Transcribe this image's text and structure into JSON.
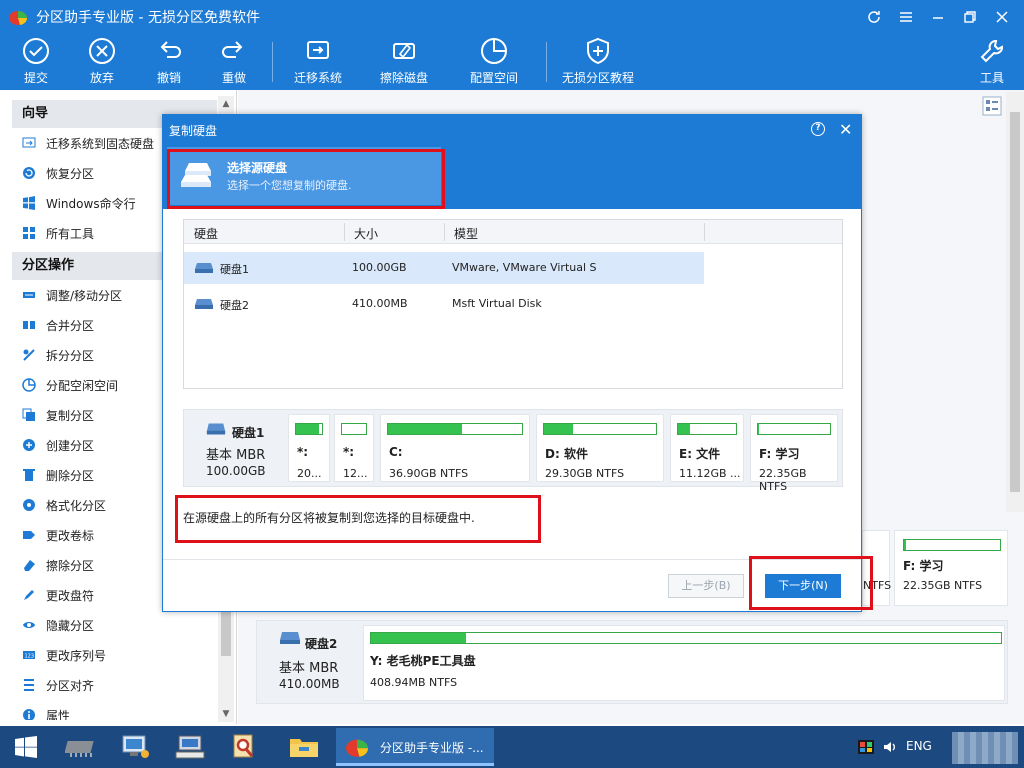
{
  "window": {
    "title": "分区助手专业版 - 无损分区免费软件"
  },
  "toolbar": {
    "commit": "提交",
    "discard": "放弃",
    "undo": "撤销",
    "redo": "重做",
    "migrate": "迁移系统",
    "wipe": "擦除磁盘",
    "allocate": "配置空间",
    "tutorial": "无损分区教程",
    "tools": "工具"
  },
  "sidebar": {
    "wizard_head": "向导",
    "wizard": [
      {
        "label": "迁移系统到固态硬盘",
        "icon": "migrate-icon"
      },
      {
        "label": "恢复分区",
        "icon": "recover-icon"
      },
      {
        "label": "Windows命令行",
        "icon": "windows-icon"
      },
      {
        "label": "所有工具",
        "icon": "grid-icon"
      }
    ],
    "ops_head": "分区操作",
    "ops": [
      {
        "label": "调整/移动分区",
        "icon": "resize-icon"
      },
      {
        "label": "合并分区",
        "icon": "merge-icon"
      },
      {
        "label": "拆分分区",
        "icon": "split-icon"
      },
      {
        "label": "分配空闲空间",
        "icon": "allocate-icon"
      },
      {
        "label": "复制分区",
        "icon": "copy-icon"
      },
      {
        "label": "创建分区",
        "icon": "create-icon"
      },
      {
        "label": "删除分区",
        "icon": "delete-icon"
      },
      {
        "label": "格式化分区",
        "icon": "format-icon"
      },
      {
        "label": "更改卷标",
        "icon": "label-icon"
      },
      {
        "label": "擦除分区",
        "icon": "eraser-icon"
      },
      {
        "label": "更改盘符",
        "icon": "letter-icon"
      },
      {
        "label": "隐藏分区",
        "icon": "eye-icon"
      },
      {
        "label": "更改序列号",
        "icon": "serial-icon"
      },
      {
        "label": "分区对齐",
        "icon": "align-icon"
      },
      {
        "label": "属性",
        "icon": "info-icon"
      }
    ]
  },
  "background": {
    "f_card": {
      "name": "F: 学习",
      "size": "22.35GB NTFS",
      "used": 0.02
    },
    "disk2": {
      "name": "硬盘2",
      "type": "基本 MBR",
      "size": "410.00MB",
      "part_name": "Y: 老毛桃PE工具盘",
      "part_size": "408.94MB NTFS",
      "used": 0.15,
      "partial_label": "NTFS"
    }
  },
  "dialog": {
    "title": "复制硬盘",
    "step_title": "选择源硬盘",
    "step_desc": "选择一个您想复制的硬盘.",
    "columns": [
      "硬盘",
      "大小",
      "模型"
    ],
    "disks": [
      {
        "name": "硬盘1",
        "size": "100.00GB",
        "model": "VMware, VMware Virtual S",
        "selected": true
      },
      {
        "name": "硬盘2",
        "size": "410.00MB",
        "model": "Msft    Virtual Disk",
        "selected": false
      }
    ],
    "map": {
      "disk_name": "硬盘1",
      "disk_type": "基本 MBR",
      "disk_size": "100.00GB",
      "partitions": [
        {
          "name": "*:",
          "size": "20...",
          "used": 0.9
        },
        {
          "name": "*:",
          "size": "12...",
          "used": 0.0
        },
        {
          "name": "C:",
          "size": "36.90GB NTFS",
          "used": 0.55
        },
        {
          "name": "D: 软件",
          "size": "29.30GB NTFS",
          "used": 0.26
        },
        {
          "name": "E: 文件",
          "size": "11.12GB ...",
          "used": 0.2
        },
        {
          "name": "F: 学习",
          "size": "22.35GB NTFS",
          "used": 0.02
        }
      ]
    },
    "info": "在源硬盘上的所有分区将被复制到您选择的目标硬盘中.",
    "prev": "上一步(B)",
    "next": "下一步(N)"
  },
  "taskbar": {
    "active_app": "分区助手专业版 -...",
    "lang": "ENG"
  }
}
